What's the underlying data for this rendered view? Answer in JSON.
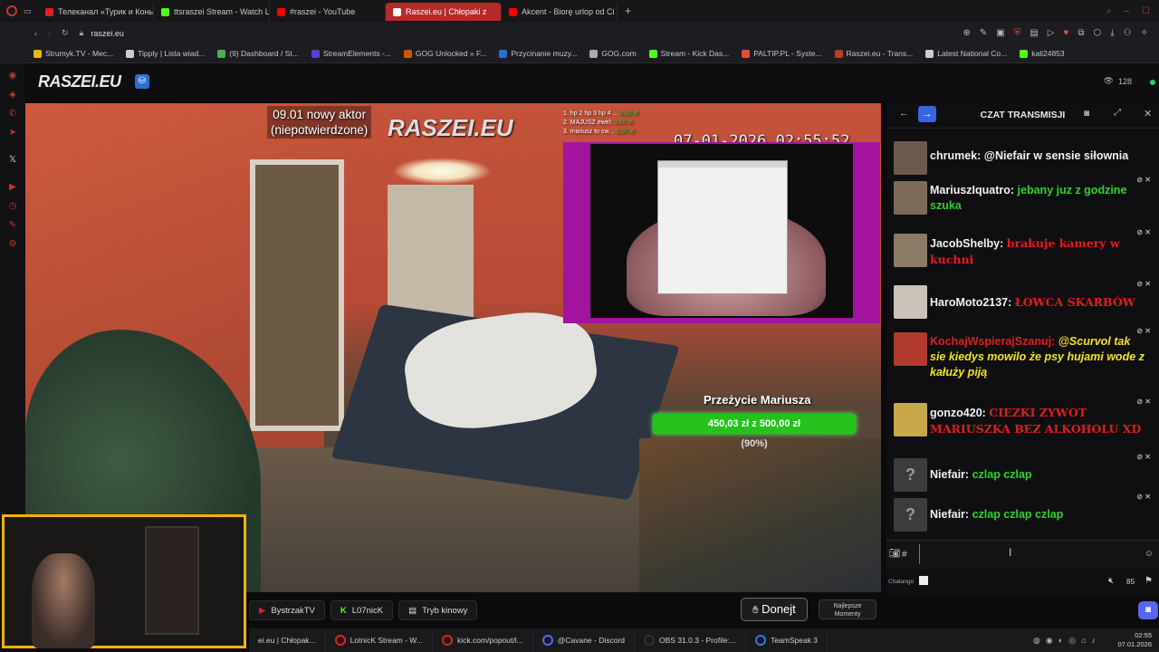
{
  "browser": {
    "tabs": [
      {
        "label": "Телеканал «Турик и Конь",
        "color": "#e02020"
      },
      {
        "label": "ttsraszei Stream - Watch L",
        "color": "#53fc18"
      },
      {
        "label": "#raszei - YouTube",
        "color": "#ff0000"
      },
      {
        "label": "Raszei.eu | Chłopaki z",
        "color": "#ffffff",
        "active": true
      },
      {
        "label": "Akcent - Biorę urlop od Ci",
        "color": "#ff0000"
      }
    ],
    "new_tab": "+",
    "url": "raszei.eu",
    "bookmarks": [
      {
        "label": "Strumyk.TV - Mec...",
        "color": "#e6b800"
      },
      {
        "label": "Tipply | Lista wiad...",
        "color": "#cccccc"
      },
      {
        "label": "(9) Dashboard / St...",
        "color": "#4caf50"
      },
      {
        "label": "StreamElements -...",
        "color": "#5a3fd6"
      },
      {
        "label": "GOG Unlocked » F...",
        "color": "#d35400"
      },
      {
        "label": "Przycinanie muzy...",
        "color": "#2c6cd6"
      },
      {
        "label": "GOG.com",
        "color": "#aaaaaa"
      },
      {
        "label": "Stream - Kick Das...",
        "color": "#53fc18"
      },
      {
        "label": "PALTIP.PL - Syste...",
        "color": "#e74c3c"
      },
      {
        "label": "Raszei.eu - Trans...",
        "color": "#c0392b"
      },
      {
        "label": "Latest National Co...",
        "color": "#cccccc"
      },
      {
        "label": "kali24853",
        "color": "#53fc18"
      }
    ]
  },
  "site": {
    "logo": "RASZEI.EU",
    "viewers": "128"
  },
  "video": {
    "actor_line1": "09.01 nowy aktor",
    "actor_line2": "(niepotwierdzone)",
    "logo": "RASZEI.EU",
    "timestamp": "07-01-2026 02:55:52",
    "list": [
      {
        "text": "1. hp 2 hp 3 hp 4 ...",
        "amount": "3,00 zł"
      },
      {
        "text": "2. MAJUSZ ewel: ",
        "amount": "3,00 zł"
      },
      {
        "text": "3. mariusz to cw...",
        "amount": "3,00 zł"
      }
    ],
    "goal_title": "Przeżycie Mariusza",
    "goal_text": "450,03 zł z 500,00 zł",
    "goal_pct_text": "(90%)",
    "goal_fraction": 0.9
  },
  "under_video": {
    "buttons": [
      "BystrzakTV",
      "L07nicK",
      "Tryb kinowy"
    ],
    "donate": "Donejt",
    "highlights_line1": "Najlepsze",
    "highlights_line2": "Momenty"
  },
  "chat": {
    "title": "CZAT TRANSMISJI",
    "messages": [
      {
        "user": "chrumek:",
        "text": "@Niefair w sensie siłownia",
        "style": "uname"
      },
      {
        "user": "MariuszIquatro:",
        "text": "jebany juz z godzine szuka",
        "style": "txt-g"
      },
      {
        "user": "JacobShelby:",
        "text": "brakuje kamery w kuchni",
        "style": "txt-r"
      },
      {
        "user": "HaroMoto2137:",
        "text": "ŁOWCA SKARBÓW",
        "style": "txt-r"
      },
      {
        "user": "KochajWspierajSzanuj:",
        "text": "@Scurvol tak sie kiedys mowilo że psy hujami wode z kałuży piją",
        "style": "txt-y"
      },
      {
        "user": "gonzo420:",
        "text": "CIEZKI ZYWOT MARIUSZKA BEZ ALKOHOLU XD",
        "style": "txt-r"
      },
      {
        "user": "Niefair:",
        "text": "czlap czlap",
        "style": "txt-g"
      },
      {
        "user": "Niefair:",
        "text": "czlap czlap czlap",
        "style": "txt-g"
      }
    ],
    "input_prefix": "#",
    "footer_label": "Chatango",
    "volume": "85"
  },
  "taskbar": {
    "items": [
      {
        "label": "ei.eu | Chłopak...",
        "color": "#ffffff"
      },
      {
        "label": "LotnicK Stream - W...",
        "color": "#e02020"
      },
      {
        "label": "kick.com/popout/l...",
        "color": "#e02020"
      },
      {
        "label": "@Cavane - Discord",
        "color": "#5865f2"
      },
      {
        "label": "OBS 31.0.3 - Profile:...",
        "color": "#333333"
      },
      {
        "label": "TeamSpeak 3",
        "color": "#3a7bd5"
      }
    ],
    "time": "02:55",
    "date": "07.01.2026"
  }
}
